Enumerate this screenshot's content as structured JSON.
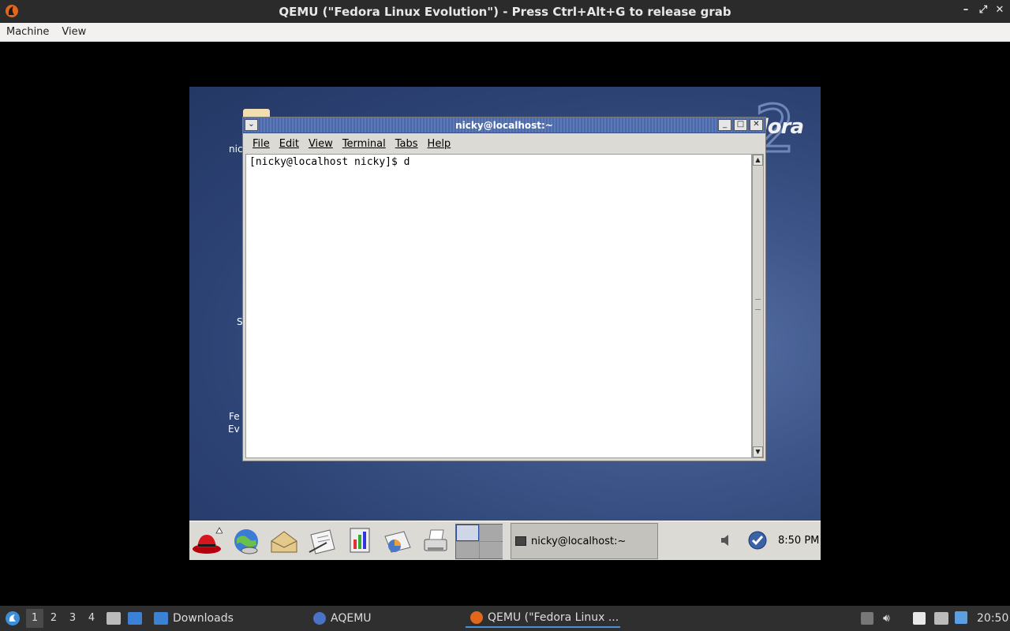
{
  "qemu": {
    "title": "QEMU (\"Fedora Linux Evolution\") - Press Ctrl+Alt+G to release grab",
    "menu": [
      "Machine",
      "View"
    ],
    "controls": [
      "–",
      "⤢",
      "✕"
    ]
  },
  "desktop": {
    "logo": "edora",
    "labels": {
      "home": "nic",
      "s": "S",
      "fe1": "Fe",
      "fe2": "Ev"
    }
  },
  "terminal": {
    "title": "nicky@localhost:~",
    "menu": [
      "File",
      "Edit",
      "View",
      "Terminal",
      "Tabs",
      "Help"
    ],
    "content": "[nicky@localhost nicky]$ d"
  },
  "guest_panel": {
    "task_label": "nicky@localhost:~",
    "clock": "8:50 PM"
  },
  "host_taskbar": {
    "workspaces": [
      "1",
      "2",
      "3",
      "4"
    ],
    "active_workspace": "1",
    "downloads": "Downloads",
    "aqemu": "AQEMU",
    "qemu_task": "QEMU (\"Fedora Linux ...",
    "clock": "20:50"
  },
  "colors": {
    "guest_title": "#4d6aa8",
    "guest_bg": "#2c4273",
    "accent": "#4a90d9"
  }
}
